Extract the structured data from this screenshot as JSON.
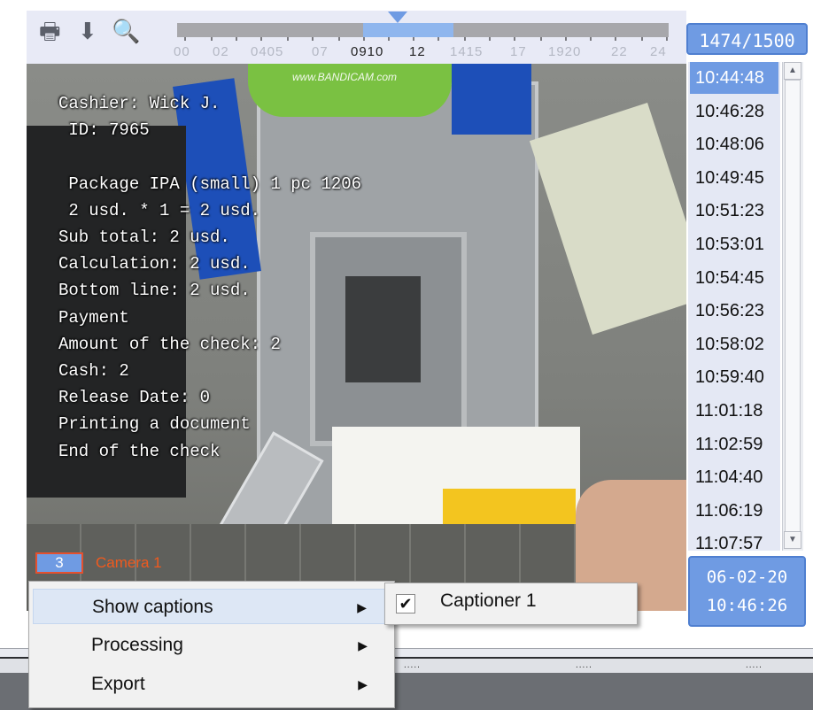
{
  "toolbar": {
    "icons": [
      "print-icon",
      "download-icon",
      "search-icon"
    ],
    "icon_glyphs": [
      "🖶",
      "⬇",
      "🔍"
    ]
  },
  "timeline": {
    "tick_labels": [
      "00",
      "02",
      "0405",
      "07",
      "0910",
      "12",
      "1415",
      "17",
      "1920",
      "22",
      "24"
    ],
    "active_labels": [
      "0910",
      "12"
    ]
  },
  "counter": "1474/1500",
  "video": {
    "watermark": "www.BANDICAM.com",
    "caption_lines": [
      "Cashier: Wick J.",
      " ID: 7965",
      "",
      " Package IPA (small) 1 pc 1206",
      " 2 usd. * 1 = 2 usd.",
      "Sub total: 2 usd.",
      "Calculation: 2 usd.",
      "Bottom line: 2 usd.",
      "Payment",
      "Amount of the check: 2",
      "Cash: 2",
      "Release Date: 0",
      "Printing a document",
      "End of the check"
    ],
    "camera_number": "3",
    "camera_name": "Camera 1"
  },
  "timelist": {
    "items": [
      "10:44:48",
      "10:46:28",
      "10:48:06",
      "10:49:45",
      "10:51:23",
      "10:53:01",
      "10:54:45",
      "10:56:23",
      "10:58:02",
      "10:59:40",
      "11:01:18",
      "11:02:59",
      "11:04:40",
      "11:06:19",
      "11:07:57"
    ],
    "selected": "10:44:48"
  },
  "datetime": {
    "date": "06-02-20",
    "time": "10:46:26"
  },
  "context_menu": {
    "items": [
      "Show captions",
      "Processing",
      "Export"
    ],
    "highlighted": "Show captions",
    "arrow": "▶",
    "submenu": {
      "label": "Captioner 1",
      "checked": true,
      "check_glyph": "✔"
    }
  },
  "bottom": {
    "dots": ".....",
    "colors": {
      "accent": "#6f9be3",
      "camera_label": "#f05a1e"
    }
  }
}
